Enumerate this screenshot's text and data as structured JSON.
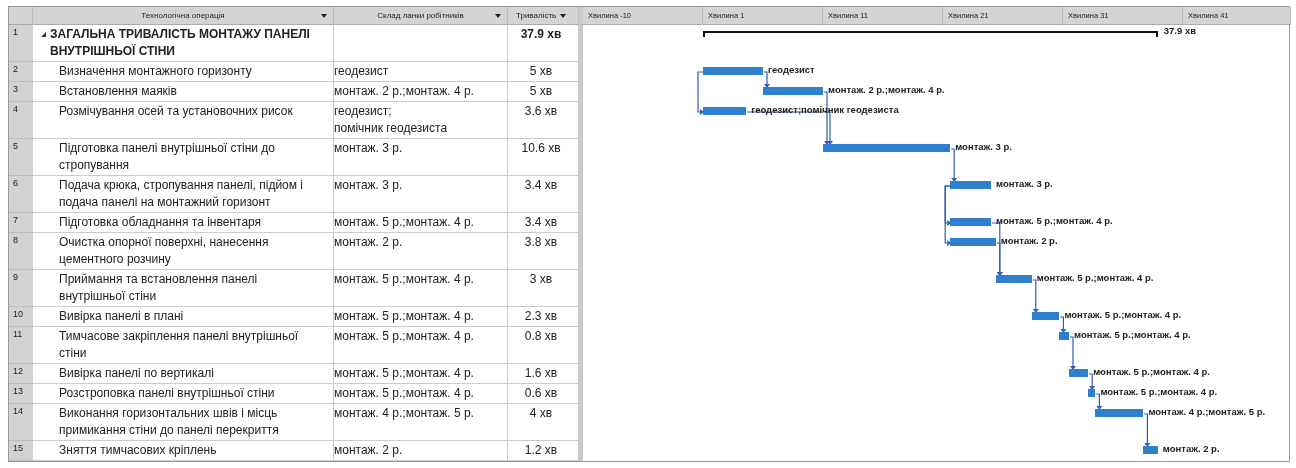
{
  "table": {
    "columns": [
      {
        "label": "Технологічна операція"
      },
      {
        "label": "Склад ланки робітників"
      },
      {
        "label": "Тривалість"
      }
    ],
    "rows": [
      {
        "number": "1",
        "kind": "summary",
        "expanded": true,
        "operation": "ЗАГАЛЬНА ТРИВАЛІСТЬ МОНТАЖУ ПАНЕЛІ ВНУТРІШНЬОЇ СТІНИ",
        "duration": "37.9 хв"
      },
      {
        "number": "2",
        "kind": "task",
        "operation": "Визначення монтажного горизонту",
        "crew": "геодезист",
        "duration": "5 хв"
      },
      {
        "number": "3",
        "kind": "task",
        "operation": "Встановлення маяків",
        "crew": "монтаж. 2 р.;монтаж. 4 р.",
        "duration": "5 хв"
      },
      {
        "number": "4",
        "kind": "task",
        "operation": "Розмічування осей та установочних рисок",
        "crew": "геодезист;\nпомічник геодезиста",
        "duration": "3.6 хв"
      },
      {
        "number": "5",
        "kind": "task",
        "operation": "Підготовка панелі внутрішньої стіни до стропування",
        "crew": "монтаж. 3 р.",
        "duration": "10.6 хв"
      },
      {
        "number": "6",
        "kind": "task",
        "operation": "Подача крюка, стропування панелі, підйом і подача панелі на монтажний горизонт",
        "crew": "монтаж. 3 р.",
        "duration": "3.4 хв"
      },
      {
        "number": "7",
        "kind": "task",
        "operation": "Підготовка обладнання та інвентаря",
        "crew": "монтаж. 5 р.;монтаж. 4 р.",
        "duration": "3.4 хв"
      },
      {
        "number": "8",
        "kind": "task",
        "operation": "Очистка опорної поверхні, нанесення цементного розчину",
        "crew": "монтаж. 2 р.",
        "duration": "3.8 хв"
      },
      {
        "number": "9",
        "kind": "task",
        "operation": "Приймання та встановлення панелі внутрішньої стіни",
        "crew": "монтаж. 5 р.;монтаж. 4 р.",
        "duration": "3 хв"
      },
      {
        "number": "10",
        "kind": "task",
        "operation": "Вивірка панелі в плані",
        "crew": "монтаж. 5 р.;монтаж. 4 р.",
        "duration": "2.3 хв"
      },
      {
        "number": "11",
        "kind": "task",
        "operation": "Тимчасове закріплення панелі внутрішньої стіни",
        "crew": "монтаж. 5 р.;монтаж. 4 р.",
        "duration": "0.8 хв"
      },
      {
        "number": "12",
        "kind": "task",
        "operation": "Вивірка панелі по вертикалі",
        "crew": "монтаж. 5 р.;монтаж. 4 р.",
        "duration": "1.6 хв"
      },
      {
        "number": "13",
        "kind": "task",
        "operation": "Розстроповка панелі внутрішньої стіни",
        "crew": "монтаж. 5 р.;монтаж. 4 р.",
        "duration": "0.6 хв"
      },
      {
        "number": "14",
        "kind": "task",
        "operation": "Виконання горизонтальних швів і місць примикання стіни до панелі перекриття",
        "crew": "монтаж. 4 р.;монтаж. 5 р.",
        "duration": "4 хв"
      },
      {
        "number": "15",
        "kind": "task",
        "operation": "Зняття тимчасових кріплень",
        "crew": "монтаж. 2 р.",
        "duration": "1.2 хв"
      }
    ]
  },
  "gantt": {
    "timescale": [
      "Хвилина -10",
      "Хвилина 1",
      "Хвилина 11",
      "Хвилина 21",
      "Хвилина 31",
      "Хвилина 41"
    ],
    "bar_labels": [
      "37.9 хв",
      "геодезист",
      "монтаж. 2 р.;монтаж. 4 р.",
      "геодезист;помічник геодезиста",
      "монтаж. 3 р.",
      "монтаж. 3 р.",
      "монтаж. 5 р.;монтаж. 4 р.",
      "монтаж. 2 р.",
      "монтаж. 5 р.;монтаж. 4 р.",
      "монтаж. 5 р.;монтаж. 4 р.",
      "монтаж. 5 р.;монтаж. 4 р.",
      "монтаж. 5 р.;монтаж. 4 р.",
      "монтаж. 5 р.;монтаж. 4 р.",
      "монтаж. 4 р.;монтаж. 5 р.",
      "монтаж. 2 р."
    ]
  }
}
